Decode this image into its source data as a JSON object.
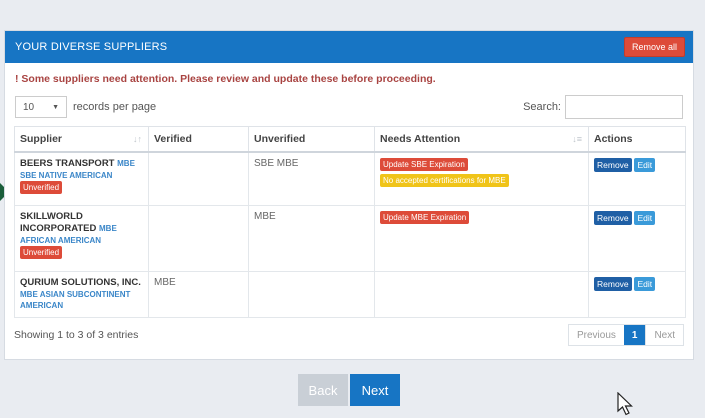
{
  "panel": {
    "title": "YOUR DIVERSE SUPPLIERS",
    "remove_all_label": "Remove all"
  },
  "warning": "! Some suppliers need attention. Please review and update these before proceeding.",
  "length": {
    "value": "10",
    "suffix": "records per page"
  },
  "search": {
    "label": "Search:",
    "value": ""
  },
  "columns": [
    "Supplier",
    "Verified",
    "Unverified",
    "Needs Attention",
    "Actions"
  ],
  "rows": [
    {
      "name": "BEERS TRANSPORT",
      "name_tag": "MBE",
      "category": "SBE NATIVE AMERICAN",
      "badge": "Unverified",
      "verified": "",
      "unverified": "SBE MBE",
      "attention": [
        "Update SBE Expiration",
        "No accepted certifications for MBE"
      ],
      "actions": [
        "Remove",
        "Edit"
      ]
    },
    {
      "name": "SKILLWORLD INCORPORATED",
      "name_tag": "MBE",
      "category": "AFRICAN AMERICAN",
      "badge": "Unverified",
      "verified": "",
      "unverified": "MBE",
      "attention": [
        "Update MBE Expiration"
      ],
      "actions": [
        "Remove",
        "Edit"
      ]
    },
    {
      "name": "QURIUM SOLUTIONS, INC.",
      "name_tag": "",
      "category": "MBE ASIAN SUBCONTINENT AMERICAN",
      "badge": "",
      "verified": "MBE",
      "unverified": "",
      "attention": [],
      "actions": [
        "Remove",
        "Edit"
      ]
    }
  ],
  "info": "Showing 1 to 3 of 3 entries",
  "pager": {
    "previous": "Previous",
    "current": "1",
    "next": "Next"
  },
  "nav": {
    "back": "Back",
    "next": "Next"
  },
  "colors": {
    "primary": "#1775c4",
    "danger": "#dd4b39",
    "warning": "#f0c419"
  },
  "icons": [
    "sort-icon",
    "caret-down-icon",
    "arrow-pointer-icon",
    "mouse-cursor-icon"
  ]
}
